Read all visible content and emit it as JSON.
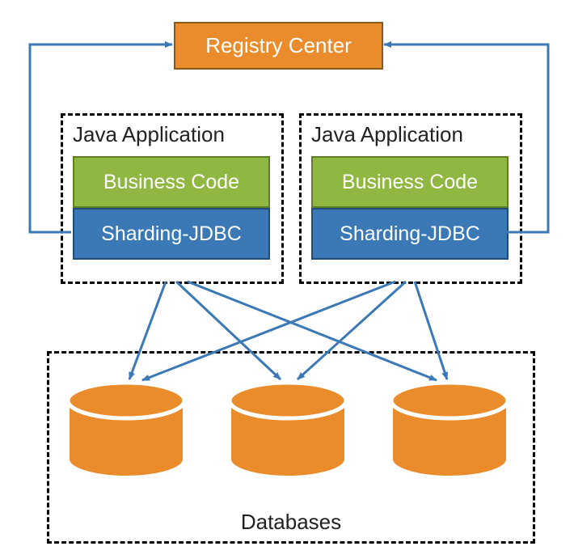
{
  "registry": {
    "label": "Registry Center"
  },
  "apps": {
    "left": {
      "title": "Java Application",
      "business": "Business Code",
      "sharding": "Sharding-JDBC"
    },
    "right": {
      "title": "Java Application",
      "business": "Business Code",
      "sharding": "Sharding-JDBC"
    }
  },
  "databases": {
    "title": "Databases"
  },
  "colors": {
    "orange": "#eb8c2c",
    "orange_border": "#8b5a1a",
    "green": "#8fb741",
    "green_border": "#5e7d25",
    "blue": "#3a78b6",
    "blue_border": "#1f4d7a",
    "arrow": "#3a78b6"
  }
}
